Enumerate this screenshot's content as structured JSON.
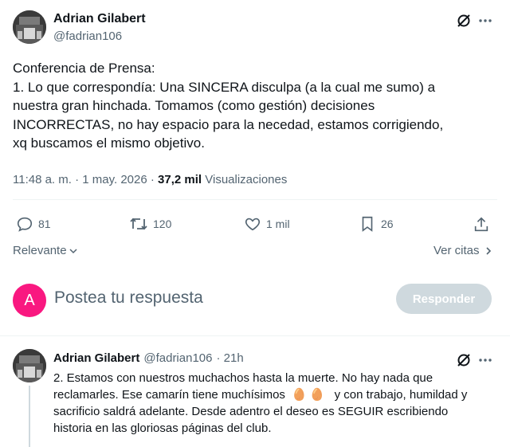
{
  "main_tweet": {
    "author_name": "Adrian Gilabert",
    "author_handle": "@fadrian106",
    "text_lines": [
      "Conferencia de Prensa:",
      "1. Lo que correspondía: Una SINCERA disculpa (a la cual me sumo) a",
      "nuestra gran hinchada. Tomamos (como gestión) decisiones",
      "INCORRECTAS, no hay espacio para la necedad, estamos corrigiendo,",
      "xq buscamos el mismo objetivo."
    ],
    "timestamp": "11:48 a. m. · 1 may. 2026 · ",
    "views_count": "37,2 mil",
    "views_label": "Visualizaciones",
    "icons": {
      "grok": "grok-slash-icon",
      "more": "more-dots-icon"
    }
  },
  "actions": {
    "replies": "81",
    "retweets": "120",
    "likes": "1 mil",
    "bookmarks": "26"
  },
  "sort": {
    "label": "Relevante",
    "quotes_label": "Ver citas"
  },
  "composer": {
    "avatar_letter": "A",
    "avatar_color": "#f91880",
    "placeholder": "Postea tu respuesta",
    "button_label": "Responder"
  },
  "reply": {
    "author_name": "Adrian Gilabert",
    "author_handle": "@fadrian106",
    "time": "· 21h",
    "line1": "2. Estamos con nuestros muchachos hasta la muerte. No hay nada que",
    "line2_a": "reclamarles. Ese camarín tiene muchísimos",
    "line2_emoji": "🥚🥚",
    "line2_b": "y con trabajo, humildad y",
    "line3": "sacrificio saldrá adelante. Desde adentro el deseo es SEGUIR escribiendo",
    "line4": "historia en las gloriosas páginas del club."
  },
  "colors": {
    "text": "#0f1419",
    "secondary": "#536471",
    "button_disabled": "#cfd9de",
    "divider": "#eff3f4"
  }
}
